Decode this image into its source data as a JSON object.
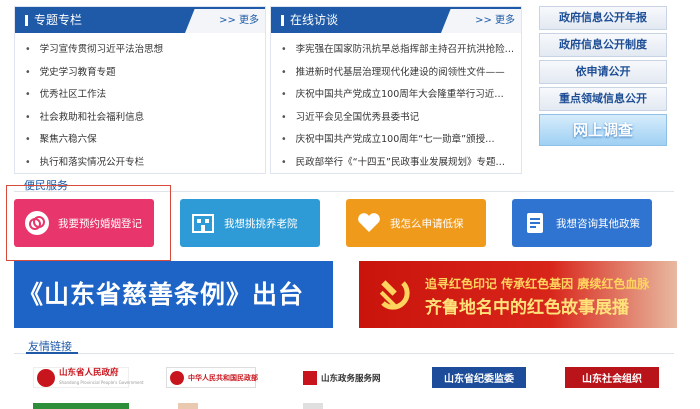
{
  "panels": [
    {
      "title": "专题专栏",
      "more": ">> 更多",
      "items": [
        "学习宣传贯彻习近平法治思想",
        "党史学习教育专题",
        "优秀社区工作法",
        "社会救助和社会福利信息",
        "聚焦六稳六保",
        "执行和落实情况公开专栏"
      ]
    },
    {
      "title": "在线访谈",
      "more": ">> 更多",
      "items": [
        "李宪强在国家防汛抗旱总指挥部主持召开抗洪抢险…",
        "推进新时代基层治理现代化建设的阅领性文件——",
        "庆祝中国共产党成立100周年大会隆重举行习近…",
        "习近平会见全国优秀县委书记",
        "庆祝中国共产党成立100周年“七一勋章”颁授…",
        "民政部举行《“十四五”民政事业发展规划》专题…"
      ]
    }
  ],
  "side_links": [
    "政府信息公开年报",
    "政府信息公开制度",
    "依申请公开",
    "重点领域信息公开"
  ],
  "survey_label": "网上调查",
  "services_title": "便民服务",
  "services": [
    {
      "label": "我要预约婚姻登记",
      "icon": "ring-icon",
      "color": "#e8356b"
    },
    {
      "label": "我想挑挑养老院",
      "icon": "building-icon",
      "color": "#2e9bd6"
    },
    {
      "label": "我怎么申请低保",
      "icon": "heart-hand-icon",
      "color": "#f09a1c"
    },
    {
      "label": "我想咨询其他政策",
      "icon": "document-icon",
      "color": "#2f74d0"
    }
  ],
  "banner_left": "《山东省慈善条例》出台",
  "banner_right": {
    "line1": "追寻红色印记  传承红色基因  赓续红色血脉",
    "line2": "齐鲁地名中的红色故事展播"
  },
  "links_title": "友情链接",
  "friend_links": [
    {
      "name": "山东省人民政府",
      "sub": "Shandong Provincial People's Government"
    },
    {
      "name": "中华人民共和国民政部",
      "sub": ""
    },
    {
      "name": "山东政务服务网",
      "sub": ""
    },
    {
      "name": "山东省纪委监委",
      "sub": ""
    },
    {
      "name": "山东社会组织",
      "sub": ""
    }
  ],
  "colors": {
    "primary": "#1e5aa8",
    "highlight_border": "#d84a3a"
  }
}
